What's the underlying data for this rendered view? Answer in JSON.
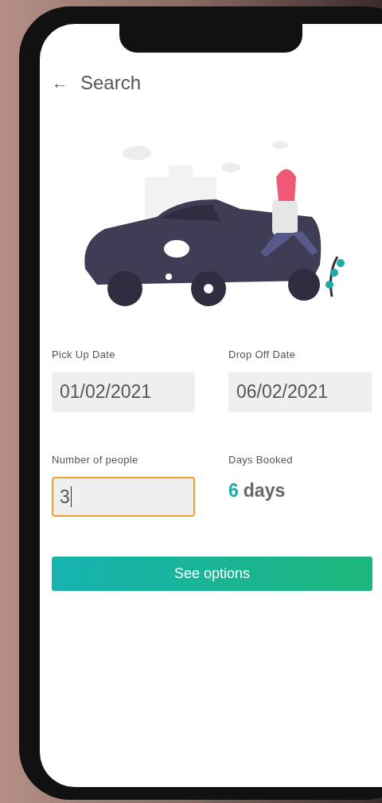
{
  "header": {
    "back_icon": "←",
    "title": "Search"
  },
  "fields": [
    {
      "kind": "date",
      "label": "Pick Up Date",
      "value": "01/02/2021",
      "focused": false
    },
    {
      "kind": "date",
      "label": "Drop Off Date",
      "value": "06/02/2021",
      "focused": false
    },
    {
      "kind": "input",
      "label": "Number of people",
      "value": "3",
      "focused": true
    },
    {
      "kind": "readout",
      "label": "Days Booked",
      "number": "6",
      "unit": "days"
    }
  ],
  "button": {
    "label": "See options"
  }
}
